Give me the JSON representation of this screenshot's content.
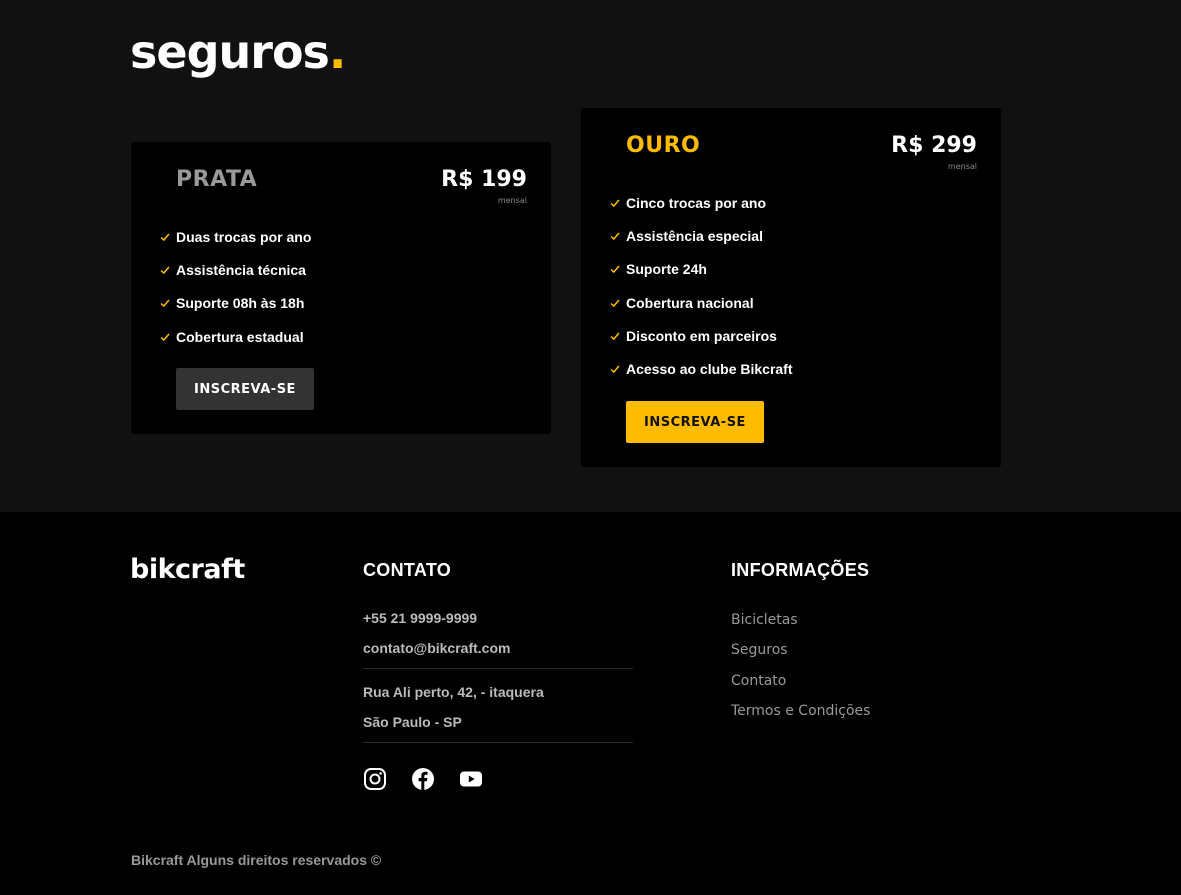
{
  "page": {
    "title": "seguros",
    "title_dot": "."
  },
  "colors": {
    "accent": "#FFBB00",
    "section_bg": "#111111",
    "card_bg": "#000000",
    "prata_name": "#999999",
    "prata_button": "#333333"
  },
  "plans": [
    {
      "name": "PRATA",
      "price": "R$ 199",
      "period": "mensal",
      "features": [
        "Duas trocas por ano",
        "Assistência técnica",
        "Suporte 08h às 18h",
        "Cobertura estadual"
      ],
      "button_label": "INSCREVA-SE"
    },
    {
      "name": "OURO",
      "price": "R$ 299",
      "period": "mensal",
      "features": [
        "Cinco trocas por ano",
        "Assistência especial",
        "Suporte 24h",
        "Cobertura nacional",
        "Disconto em parceiros",
        "Acesso ao clube Bikcraft"
      ],
      "button_label": "INSCREVA-SE"
    }
  ],
  "footer": {
    "logo": "bikcraft",
    "contato": {
      "heading": "CONTATO",
      "phone": "+55 21 9999-9999",
      "email": "contato@bikcraft.com",
      "address_line1": "Rua Ali perto, 42, - itaquera",
      "address_line2": "São Paulo - SP",
      "social_icons": [
        "instagram-icon",
        "facebook-icon",
        "youtube-icon"
      ]
    },
    "informacoes": {
      "heading": "INFORMAÇÕES",
      "links": [
        "Bicicletas",
        "Seguros",
        "Contato",
        "Termos e Condições"
      ]
    },
    "copyright": "Bikcraft Alguns direitos reservados ©"
  }
}
